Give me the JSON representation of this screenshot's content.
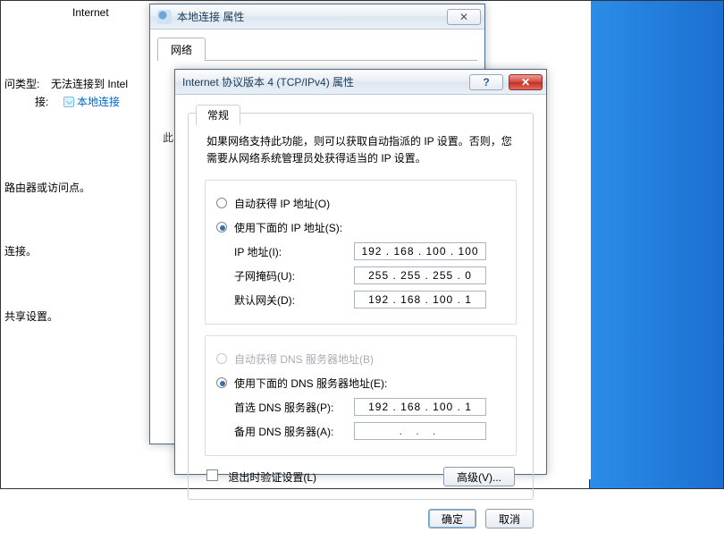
{
  "background": {
    "internet_label": "Internet",
    "conn_type_label": "问类型:",
    "conn_type_value": "无法连接到 Intel",
    "conn_target_label": "接:",
    "local_link_text": "本地连接",
    "router_text": "路由器或访问点。",
    "conn_text": "连接。",
    "share_text": "共享设置。"
  },
  "win2": {
    "title": "本地连接 属性",
    "tab": "网络",
    "partial": "此"
  },
  "ipv4": {
    "title": "Internet 协议版本 4 (TCP/IPv4) 属性",
    "tab": "常规",
    "desc": "如果网络支持此功能，则可以获取自动指派的 IP 设置。否则，您需要从网络系统管理员处获得适当的 IP 设置。",
    "radio_auto_ip": "自动获得 IP 地址(O)",
    "radio_manual_ip": "使用下面的 IP 地址(S):",
    "lbl_ip": "IP 地址(I):",
    "lbl_mask": "子网掩码(U):",
    "lbl_gateway": "默认网关(D):",
    "val_ip": "192 . 168 . 100 . 100",
    "val_mask": "255 . 255 . 255 .  0",
    "val_gateway": "192 . 168 . 100 .  1",
    "radio_auto_dns": "自动获得 DNS 服务器地址(B)",
    "radio_manual_dns": "使用下面的 DNS 服务器地址(E):",
    "lbl_dns1": "首选 DNS 服务器(P):",
    "lbl_dns2": "备用 DNS 服务器(A):",
    "val_dns1": "192 . 168 . 100 .  1",
    "val_dns2": ".       .       .",
    "chk_validate": "退出时验证设置(L)",
    "btn_adv": "高级(V)...",
    "btn_ok": "确定",
    "btn_cancel": "取消"
  }
}
